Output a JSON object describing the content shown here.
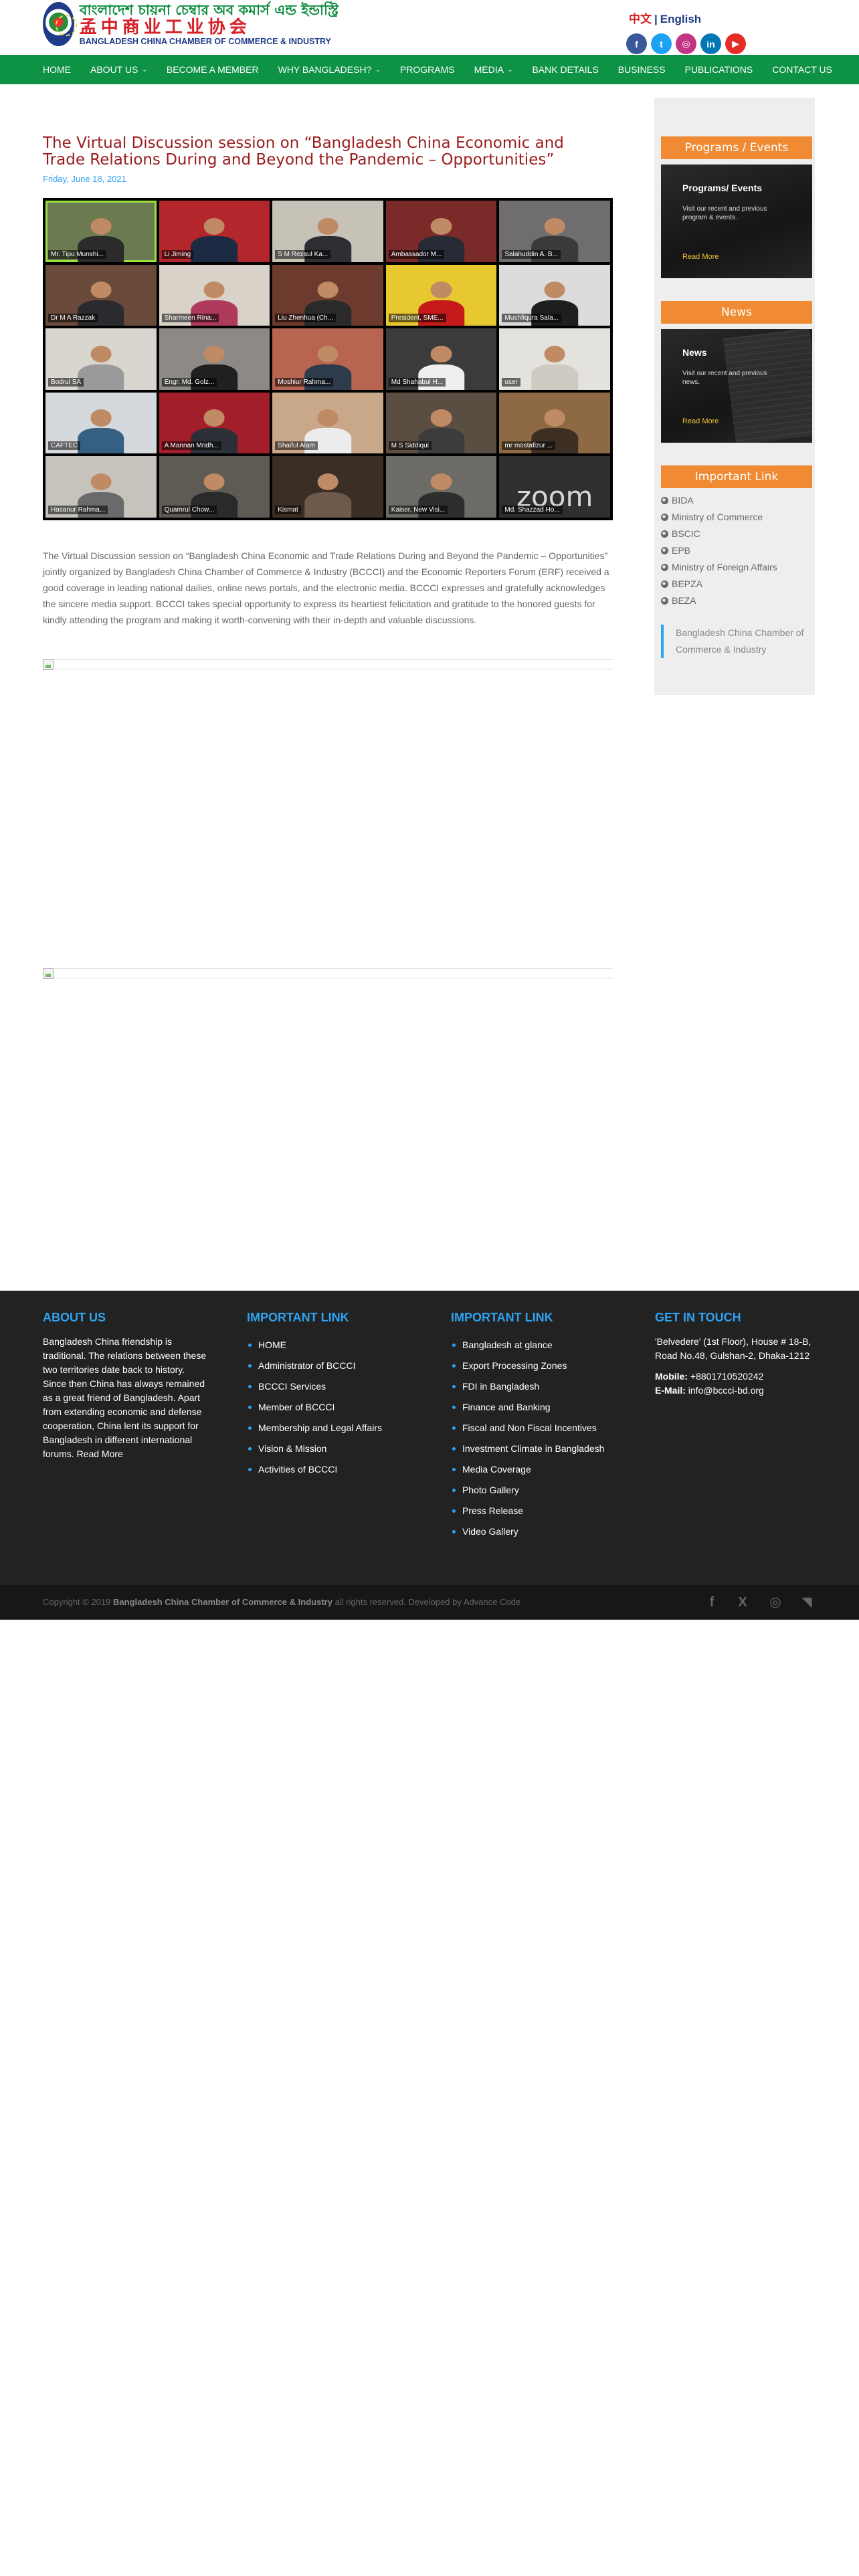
{
  "header": {
    "logo_bangla": "বাংলাদেশ চায়না চেম্বার অব কমার্স এন্ড ইন্ডাস্ট্রি",
    "logo_chinese": "孟中商业工业协会",
    "logo_english": "BANGLADESH CHINA CHAMBER OF COMMERCE & INDUSTRY",
    "lang_zh": "中文",
    "lang_sep": "|",
    "lang_en": "English",
    "socials": [
      {
        "icon": "facebook-icon",
        "glyph": "f",
        "color": "#3b5998"
      },
      {
        "icon": "twitter-icon",
        "glyph": "t",
        "color": "#1da1f2"
      },
      {
        "icon": "instagram-icon",
        "glyph": "◎",
        "color": "#c13584"
      },
      {
        "icon": "linkedin-icon",
        "glyph": "in",
        "color": "#0077b5"
      },
      {
        "icon": "youtube-icon",
        "glyph": "▶",
        "color": "#e52d27"
      }
    ]
  },
  "nav": {
    "items": [
      {
        "label": "HOME",
        "has_dropdown": false
      },
      {
        "label": "ABOUT US",
        "has_dropdown": true
      },
      {
        "label": "BECOME A MEMBER",
        "has_dropdown": false
      },
      {
        "label": "WHY BANGLADESH?",
        "has_dropdown": true
      },
      {
        "label": "PROGRAMS",
        "has_dropdown": false
      },
      {
        "label": "MEDIA",
        "has_dropdown": true
      },
      {
        "label": "BANK DETAILS",
        "has_dropdown": false
      },
      {
        "label": "BUSINESS",
        "has_dropdown": false
      },
      {
        "label": "PUBLICATIONS",
        "has_dropdown": false
      },
      {
        "label": "CONTACT US",
        "has_dropdown": false
      }
    ],
    "color": "#0e9246"
  },
  "article": {
    "title": "The Virtual Discussion session on “Bangladesh China Economic and Trade Relations During and Beyond the Pandemic – Opportunities”",
    "date": "Friday, June 18, 2021",
    "participants": [
      {
        "name": "Mr. Tipu Munshi...",
        "bg": "#6c7a52",
        "suit": "#2b2b2b",
        "active": true
      },
      {
        "name": "Li Jiming",
        "bg": "#b3262b",
        "suit": "#1d2a44"
      },
      {
        "name": "S M Rezaul Ka...",
        "bg": "#c7c2b8",
        "suit": "#2e2e33"
      },
      {
        "name": "Ambassador M...",
        "bg": "#7a2a28",
        "suit": "#262b35"
      },
      {
        "name": "Salahuddin A. B...",
        "bg": "#6f6d6e",
        "suit": "#3a3a3a"
      },
      {
        "name": "Dr M A Razzak",
        "bg": "#6a4a3a",
        "suit": "#2b2a2e"
      },
      {
        "name": "Sharmeen Rina...",
        "bg": "#d8d2c8",
        "suit": "#b03a5b"
      },
      {
        "name": "Liu Zhenhua (Ch...",
        "bg": "#6d3b2d",
        "suit": "#2a2a2a"
      },
      {
        "name": "President, SME...",
        "bg": "#e7c830",
        "suit": "#c61a1a"
      },
      {
        "name": "Mushfiqura Sala...",
        "bg": "#dcdcdc",
        "suit": "#1e1e1e"
      },
      {
        "name": "Bodrul SA",
        "bg": "#d9d6cf",
        "suit": "#9a9a9a"
      },
      {
        "name": "Engr. Md. Golz...",
        "bg": "#8d8a86",
        "suit": "#202020"
      },
      {
        "name": "Moshiur Rahma...",
        "bg": "#b76450",
        "suit": "#2d3b4d"
      },
      {
        "name": "Md Shahabul H...",
        "bg": "#3b3b3b",
        "suit": "#efefef"
      },
      {
        "name": "user",
        "bg": "#e4e2dd",
        "suit": "#cfcac2"
      },
      {
        "name": "CAFTEC",
        "bg": "#d5d8dc",
        "suit": "#356083"
      },
      {
        "name": "A Mannan Mridh...",
        "bg": "#a31e2b",
        "suit": "#2c2f38"
      },
      {
        "name": "Shaiful Alam",
        "bg": "#c9a88a",
        "suit": "#ececec"
      },
      {
        "name": "M S Siddiqui",
        "bg": "#5a4d42",
        "suit": "#3c3c3c"
      },
      {
        "name": "mr mostafizur ...",
        "bg": "#8d6a44",
        "suit": "#3e2f25"
      },
      {
        "name": "Hasanur Rahma...",
        "bg": "#c6c3bd",
        "suit": "#6a6a6a"
      },
      {
        "name": "Quamrul Chow...",
        "bg": "#5e5a54",
        "suit": "#2a2a2a"
      },
      {
        "name": "Kismat",
        "bg": "#3a2e27",
        "suit": "#6d5a4b"
      },
      {
        "name": "Kaiser, New Visi...",
        "bg": "#6d6b66",
        "suit": "#2e2e2e"
      },
      {
        "name": "Md. Shazzad Ho...",
        "bg": "#2f2f2f",
        "suit": "#555555",
        "zoom_text": "zoom"
      }
    ],
    "body": "The Virtual Discussion session on “Bangladesh China Economic and Trade Relations During and Beyond the Pandemic – Opportunities” jointly organized by Bangladesh China Chamber of Commerce & Industry (BCCCI) and the Economic Reporters Forum (ERF) received a good coverage in leading national dailies, online news portals, and the electronic media. BCCCI expresses and gratefully acknowledges the sincere media support. BCCCI takes special opportunity to express its heartiest felicitation and gratitude to the honored guests for kindly attending the program and making it worth-convening with their in-depth and valuable discussions."
  },
  "sidebar": {
    "programs": {
      "header": "Programs / Events",
      "card_title": "Programs/ Events",
      "card_desc": "Visit our recent and previous program & events.",
      "read_more": "Read More"
    },
    "news": {
      "header": "News",
      "card_title": "News",
      "card_desc": "Visit our recent and previous news.",
      "read_more": "Read More"
    },
    "important_link": {
      "header": "Important Link",
      "links": [
        "BIDA",
        "Ministry of Commerce",
        "BSCIC",
        "EPB",
        "Ministry of Foreign Affairs",
        "BEPZA",
        "BEZA"
      ]
    },
    "quote": "Bangladesh China Chamber of Commerce & Industry",
    "accent": "#f08b34"
  },
  "footer": {
    "about": {
      "title": "ABOUT US",
      "text": "Bangladesh China friendship is traditional. The relations between these two territories date back to history. Since then China has always remained as a great friend of Bangladesh. Apart from extending economic and defense cooperation, China lent its support for Bangladesh in different international forums. Read More"
    },
    "links1": {
      "title": "IMPORTANT LINK",
      "items": [
        "HOME",
        "Administrator of BCCCI",
        "BCCCI Services",
        "Member of BCCCI",
        "Membership and Legal Affairs",
        "Vision & Mission",
        "Activities of BCCCI"
      ]
    },
    "links2": {
      "title": "IMPORTANT LINK",
      "items": [
        "Bangladesh at glance",
        "Export Processing Zones",
        "FDI in Bangladesh",
        "Finance and Banking",
        "Fiscal and Non Fiscal Incentives",
        "Investment Climate in Bangladesh",
        "Media Coverage",
        "Photo Gallery",
        "Press Release",
        "Video Gallery"
      ]
    },
    "contact": {
      "title": "GET IN TOUCH",
      "address": "'Belvedere' (1st Floor), House # 18-B, Road No.48, Gulshan-2, Dhaka-1212",
      "mobile_label": "Mobile:",
      "mobile": "+8801710520242",
      "email_label": "E-Mail:",
      "email": "info@bccci-bd.org"
    },
    "copyright_pre": "Copyright © 2019",
    "copyright_org": "Bangladesh China Chamber of Commerce & Industry",
    "copyright_post": "all rights reserved. Developed by Advance Code",
    "socials": [
      {
        "icon": "facebook-icon",
        "glyph": "f"
      },
      {
        "icon": "x-icon",
        "glyph": "X"
      },
      {
        "icon": "instagram-icon",
        "glyph": "◎"
      },
      {
        "icon": "rss-icon",
        "glyph": "◥"
      }
    ]
  }
}
